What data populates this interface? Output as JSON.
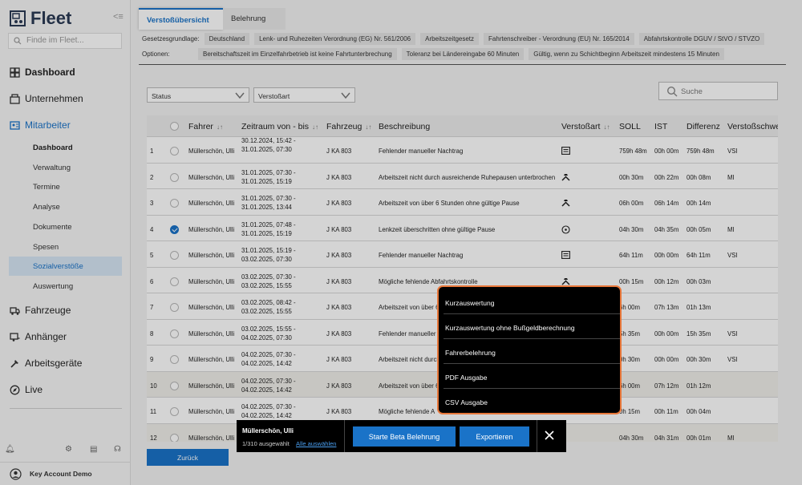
{
  "app": {
    "name": "Fleet",
    "search_placeholder": "Finde im Fleet..."
  },
  "sidebar": {
    "main_items": [
      {
        "label": "Dashboard",
        "icon": "dashboard-icon"
      },
      {
        "label": "Unternehmen",
        "icon": "building-icon"
      },
      {
        "label": "Mitarbeiter",
        "icon": "id-card-icon"
      }
    ],
    "sub_items": [
      "Dashboard",
      "Verwaltung",
      "Termine",
      "Analyse",
      "Dokumente",
      "Spesen",
      "Sozialverstöße",
      "Auswertung"
    ],
    "lower_items": [
      {
        "label": "Fahrzeuge",
        "icon": "truck-icon"
      },
      {
        "label": "Anhänger",
        "icon": "trailer-icon"
      },
      {
        "label": "Arbeitsgeräte",
        "icon": "tool-icon"
      },
      {
        "label": "Live",
        "icon": "compass-icon"
      }
    ],
    "user": "Key Account Demo"
  },
  "tabs": [
    "Verstoßübersicht",
    "Belehrung"
  ],
  "legal_basis": {
    "label": "Gesetzesgrundlage:",
    "chips": [
      "Deutschland",
      "Lenk- und Ruhezeiten Verordnung (EG) Nr. 561/2006",
      "Arbeitszeitgesetz",
      "Fahrtenschreiber - Verordnung (EU) Nr. 165/2014",
      "Abfahrtskontrolle DGUV / StVO / STVZO"
    ]
  },
  "options": {
    "label": "Optionen:",
    "chips": [
      "Bereitschaftszeit im Einzelfahrbetrieb ist keine Fahrtunterbrechung",
      "Toleranz bei Ländereingabe 60 Minuten",
      "Gültig, wenn zu Schichtbeginn Arbeitszeit mindestens 15 Minuten"
    ]
  },
  "filters": {
    "status": "Status",
    "type": "Verstoßart",
    "search_placeholder": "Suche"
  },
  "table": {
    "headers": {
      "driver": "Fahrer",
      "period": "Zeitraum von - bis",
      "vehicle": "Fahrzeug",
      "description": "Beschreibung",
      "type": "Verstoßart",
      "target": "SOLL",
      "actual": "IST",
      "diff": "Differenz",
      "severity": "Verstoßschwe"
    },
    "rows": [
      {
        "num": "1",
        "driver": "Müllerschön, Ulli",
        "from": "30.12.2024, 15:42 -",
        "to": "31.01.2025, 07:30",
        "vehicle": "J KA 803",
        "desc": "Fehlender manueller Nachtrag",
        "icon": "document-icon",
        "target": "759h 48m",
        "actual": "00h 00m",
        "diff": "759h 48m",
        "sev": "VSI",
        "checked": false
      },
      {
        "num": "2",
        "driver": "Müllerschön, Ulli",
        "from": "31.01.2025, 07:30 -",
        "to": "31.01.2025, 15:19",
        "vehicle": "J KA 803",
        "desc": "Arbeitszeit nicht durch ausreichende Ruhepausen unterbrochen",
        "icon": "hammer-icon",
        "target": "00h 30m",
        "actual": "00h 22m",
        "diff": "00h 08m",
        "sev": "MI",
        "checked": false
      },
      {
        "num": "3",
        "driver": "Müllerschön, Ulli",
        "from": "31.01.2025, 07:30 -",
        "to": "31.01.2025, 13:44",
        "vehicle": "J KA 803",
        "desc": "Arbeitszeit von über 6 Stunden ohne gültige Pause",
        "icon": "hammer-icon",
        "target": "06h 00m",
        "actual": "06h 14m",
        "diff": "00h 14m",
        "sev": "",
        "checked": false
      },
      {
        "num": "4",
        "driver": "Müllerschön, Ulli",
        "from": "31.01.2025, 07:48 -",
        "to": "31.01.2025, 15:19",
        "vehicle": "J KA 803",
        "desc": "Lenkzeit überschritten ohne gültige Pause",
        "icon": "steering-wheel-icon",
        "target": "04h 30m",
        "actual": "04h 35m",
        "diff": "00h 05m",
        "sev": "MI",
        "checked": true
      },
      {
        "num": "5",
        "driver": "Müllerschön, Ulli",
        "from": "31.01.2025, 15:19 -",
        "to": "03.02.2025, 07:30",
        "vehicle": "J KA 803",
        "desc": "Fehlender manueller Nachtrag",
        "icon": "document-icon",
        "target": "64h 11m",
        "actual": "00h 00m",
        "diff": "64h 11m",
        "sev": "VSI",
        "checked": false
      },
      {
        "num": "6",
        "driver": "Müllerschön, Ulli",
        "from": "03.02.2025, 07:30 -",
        "to": "03.02.2025, 15:55",
        "vehicle": "J KA 803",
        "desc": "Mögliche fehlende Abfahrtskontrolle",
        "icon": "hammer-icon",
        "target": "00h 15m",
        "actual": "00h 12m",
        "diff": "00h 03m",
        "sev": "",
        "checked": false
      },
      {
        "num": "7",
        "driver": "Müllerschön, Ulli",
        "from": "03.02.2025, 08:42 -",
        "to": "03.02.2025, 15:55",
        "vehicle": "J KA 803",
        "desc": "Arbeitszeit von über 6",
        "icon": "",
        "target": "6h 00m",
        "actual": "07h 13m",
        "diff": "01h 13m",
        "sev": "",
        "checked": false
      },
      {
        "num": "8",
        "driver": "Müllerschön, Ulli",
        "from": "03.02.2025, 15:55 -",
        "to": "04.02.2025, 07:30",
        "vehicle": "J KA 803",
        "desc": "Fehlender manueller N",
        "icon": "",
        "target": "5h 35m",
        "actual": "00h 00m",
        "diff": "15h 35m",
        "sev": "VSI",
        "checked": false
      },
      {
        "num": "9",
        "driver": "Müllerschön, Ulli",
        "from": "04.02.2025, 07:30 -",
        "to": "04.02.2025, 14:42",
        "vehicle": "J KA 803",
        "desc": "Arbeitszeit nicht durch",
        "icon": "",
        "target": "0h 30m",
        "actual": "00h 00m",
        "diff": "00h 30m",
        "sev": "VSI",
        "checked": false
      },
      {
        "num": "10",
        "driver": "Müllerschön, Ulli",
        "from": "04.02.2025, 07:30 -",
        "to": "04.02.2025, 14:42",
        "vehicle": "J KA 803",
        "desc": "Arbeitszeit von über 6",
        "icon": "",
        "target": "6h 00m",
        "actual": "07h 12m",
        "diff": "01h 12m",
        "sev": "",
        "checked": false
      },
      {
        "num": "11",
        "driver": "Müllerschön, Ulli",
        "from": "04.02.2025, 07:30 -",
        "to": "04.02.2025, 14:42",
        "vehicle": "J KA 803",
        "desc": "Mögliche fehlende A",
        "icon": "",
        "target": "0h 15m",
        "actual": "00h 11m",
        "diff": "00h 04m",
        "sev": "",
        "checked": false
      },
      {
        "num": "12",
        "driver": "Müllerschön, Ulli",
        "from": "",
        "to": "",
        "vehicle": "",
        "desc": "",
        "icon": "",
        "target": "04h 30m",
        "actual": "04h 31m",
        "diff": "00h 01m",
        "sev": "MI",
        "checked": false
      }
    ]
  },
  "back_button": "Zurück",
  "export_menu": [
    "Kurzauswertung",
    "Kurzauswertung ohne Bußgeldberechnung",
    "Fahrerbelehrung",
    "PDF Ausgabe",
    "CSV Ausgabe"
  ],
  "action_bar": {
    "name": "Müllerschön, Ulli",
    "count": "1/310 ausgewählt",
    "select_all": "Alle auswählen",
    "start": "Starte Beta Belehrung",
    "export": "Exportieren"
  },
  "colors": {
    "accent": "#1a73c8",
    "menu_border": "#e8773a",
    "menu_bg": "#000000"
  }
}
